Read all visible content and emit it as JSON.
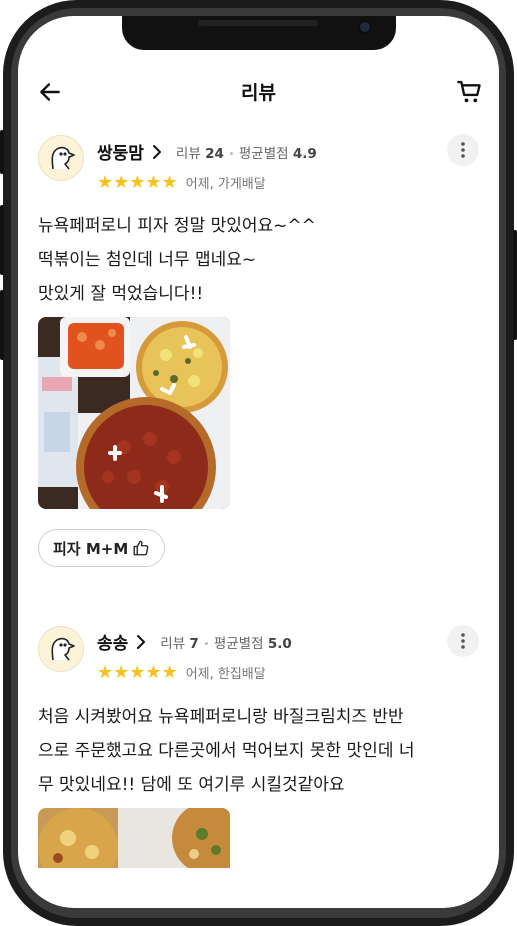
{
  "header": {
    "title": "리뷰",
    "back_icon": "arrow-left-icon",
    "cart_icon": "cart-icon"
  },
  "reviews": [
    {
      "nickname": "쌍둥맘",
      "review_label": "리뷰",
      "review_count": "24",
      "avg_label": "평균별점",
      "avg_rating": "4.9",
      "stars": "★★★★★",
      "rating": 5,
      "when": "어제, 가게배달",
      "lines": [
        "뉴욕페퍼로니 피자 정말 맛있어요~^^",
        "떡볶이는 첨인데 너무 맵네요~",
        "맛있게 잘 먹었습니다!!"
      ],
      "menu_chip": "피자 M+M"
    },
    {
      "nickname": "송송",
      "review_label": "리뷰",
      "review_count": "7",
      "avg_label": "평균별점",
      "avg_rating": "5.0",
      "stars": "★★★★★",
      "rating": 5,
      "when": "어제, 한집배달",
      "lines": [
        "처음 시켜봤어요 뉴욕페퍼로니랑 바질크림치즈 반반",
        "으로 주문했고요 다른곳에서 먹어보지 못한 맛인데 너",
        "무 맛있네요!! 담에 또 여기루 시킬것같아요"
      ]
    }
  ],
  "colors": {
    "star": "#f7c11f",
    "text": "#1a1a1a",
    "meta": "#666666"
  }
}
